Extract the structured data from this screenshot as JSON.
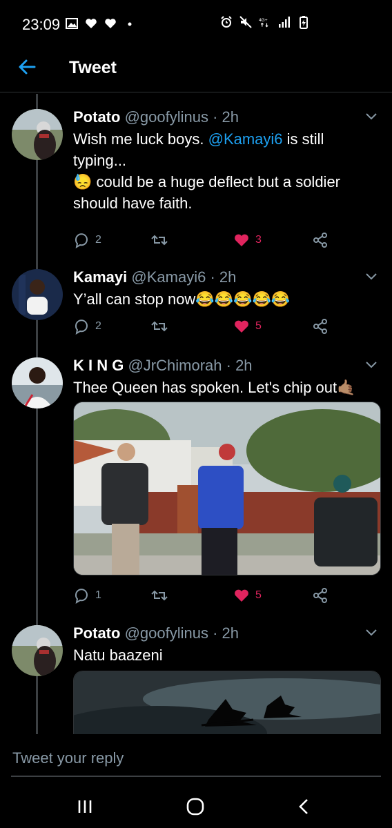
{
  "status_bar": {
    "time": "23:09",
    "left_icons": [
      "gallery-icon",
      "heart-icon",
      "heart-icon",
      "dot-icon"
    ],
    "right_icons": [
      "alarm-icon",
      "mute-icon",
      "4g-icon",
      "signal-icon",
      "battery-icon"
    ],
    "network_label": "4G+"
  },
  "header": {
    "title": "Tweet"
  },
  "tweets": [
    {
      "name": "Potato",
      "handle": "@goofylinus",
      "time": "· 2h",
      "text_parts": [
        "Wish me luck boys. ",
        "@Kamayi6",
        " is still typing...",
        "could be a huge deflect but a soldier should have faith."
      ],
      "replies": "2",
      "likes": "3",
      "liked": true
    },
    {
      "name": "Kamayi",
      "handle": "@Kamayi6",
      "time": "· 2h",
      "text": "Y’all can stop now😂😂😂😂😂",
      "replies": "2",
      "likes": "5",
      "liked": true
    },
    {
      "name": "K I N G",
      "handle": "@JrChimorah",
      "time": "· 2h",
      "text": "Thee Queen has spoken. Let's chip out🤙🏽",
      "replies": "1",
      "likes": "5",
      "liked": true
    },
    {
      "name": "Potato",
      "handle": "@goofylinus",
      "time": "· 2h",
      "text": "Natu baazeni"
    }
  ],
  "reply_bar": {
    "placeholder": "Tweet your reply"
  },
  "colors": {
    "background": "#000000",
    "accent": "#1da1f2",
    "like": "#e0245e",
    "muted": "#8899a6"
  }
}
